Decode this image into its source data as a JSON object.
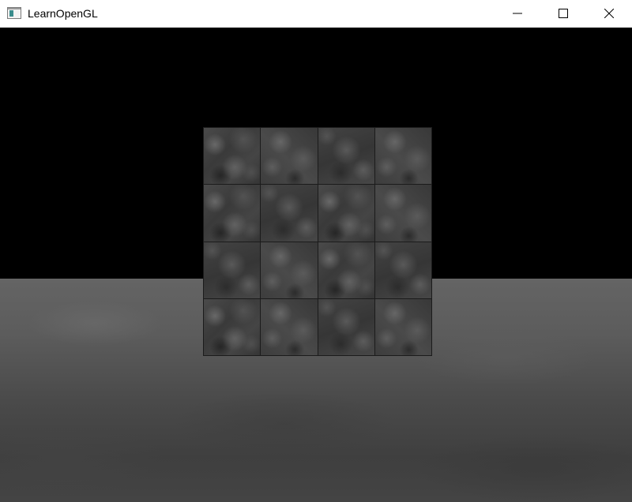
{
  "window": {
    "title": "LearnOpenGL",
    "icon": "app-window-icon",
    "controls": {
      "minimize": "minimize-icon",
      "maximize": "maximize-icon",
      "close": "close-icon"
    }
  },
  "scene": {
    "background_color": "#000000",
    "floor_color": "#5a5a5a",
    "cube_color": "#3f3f3f",
    "cube_tiles": 16
  }
}
